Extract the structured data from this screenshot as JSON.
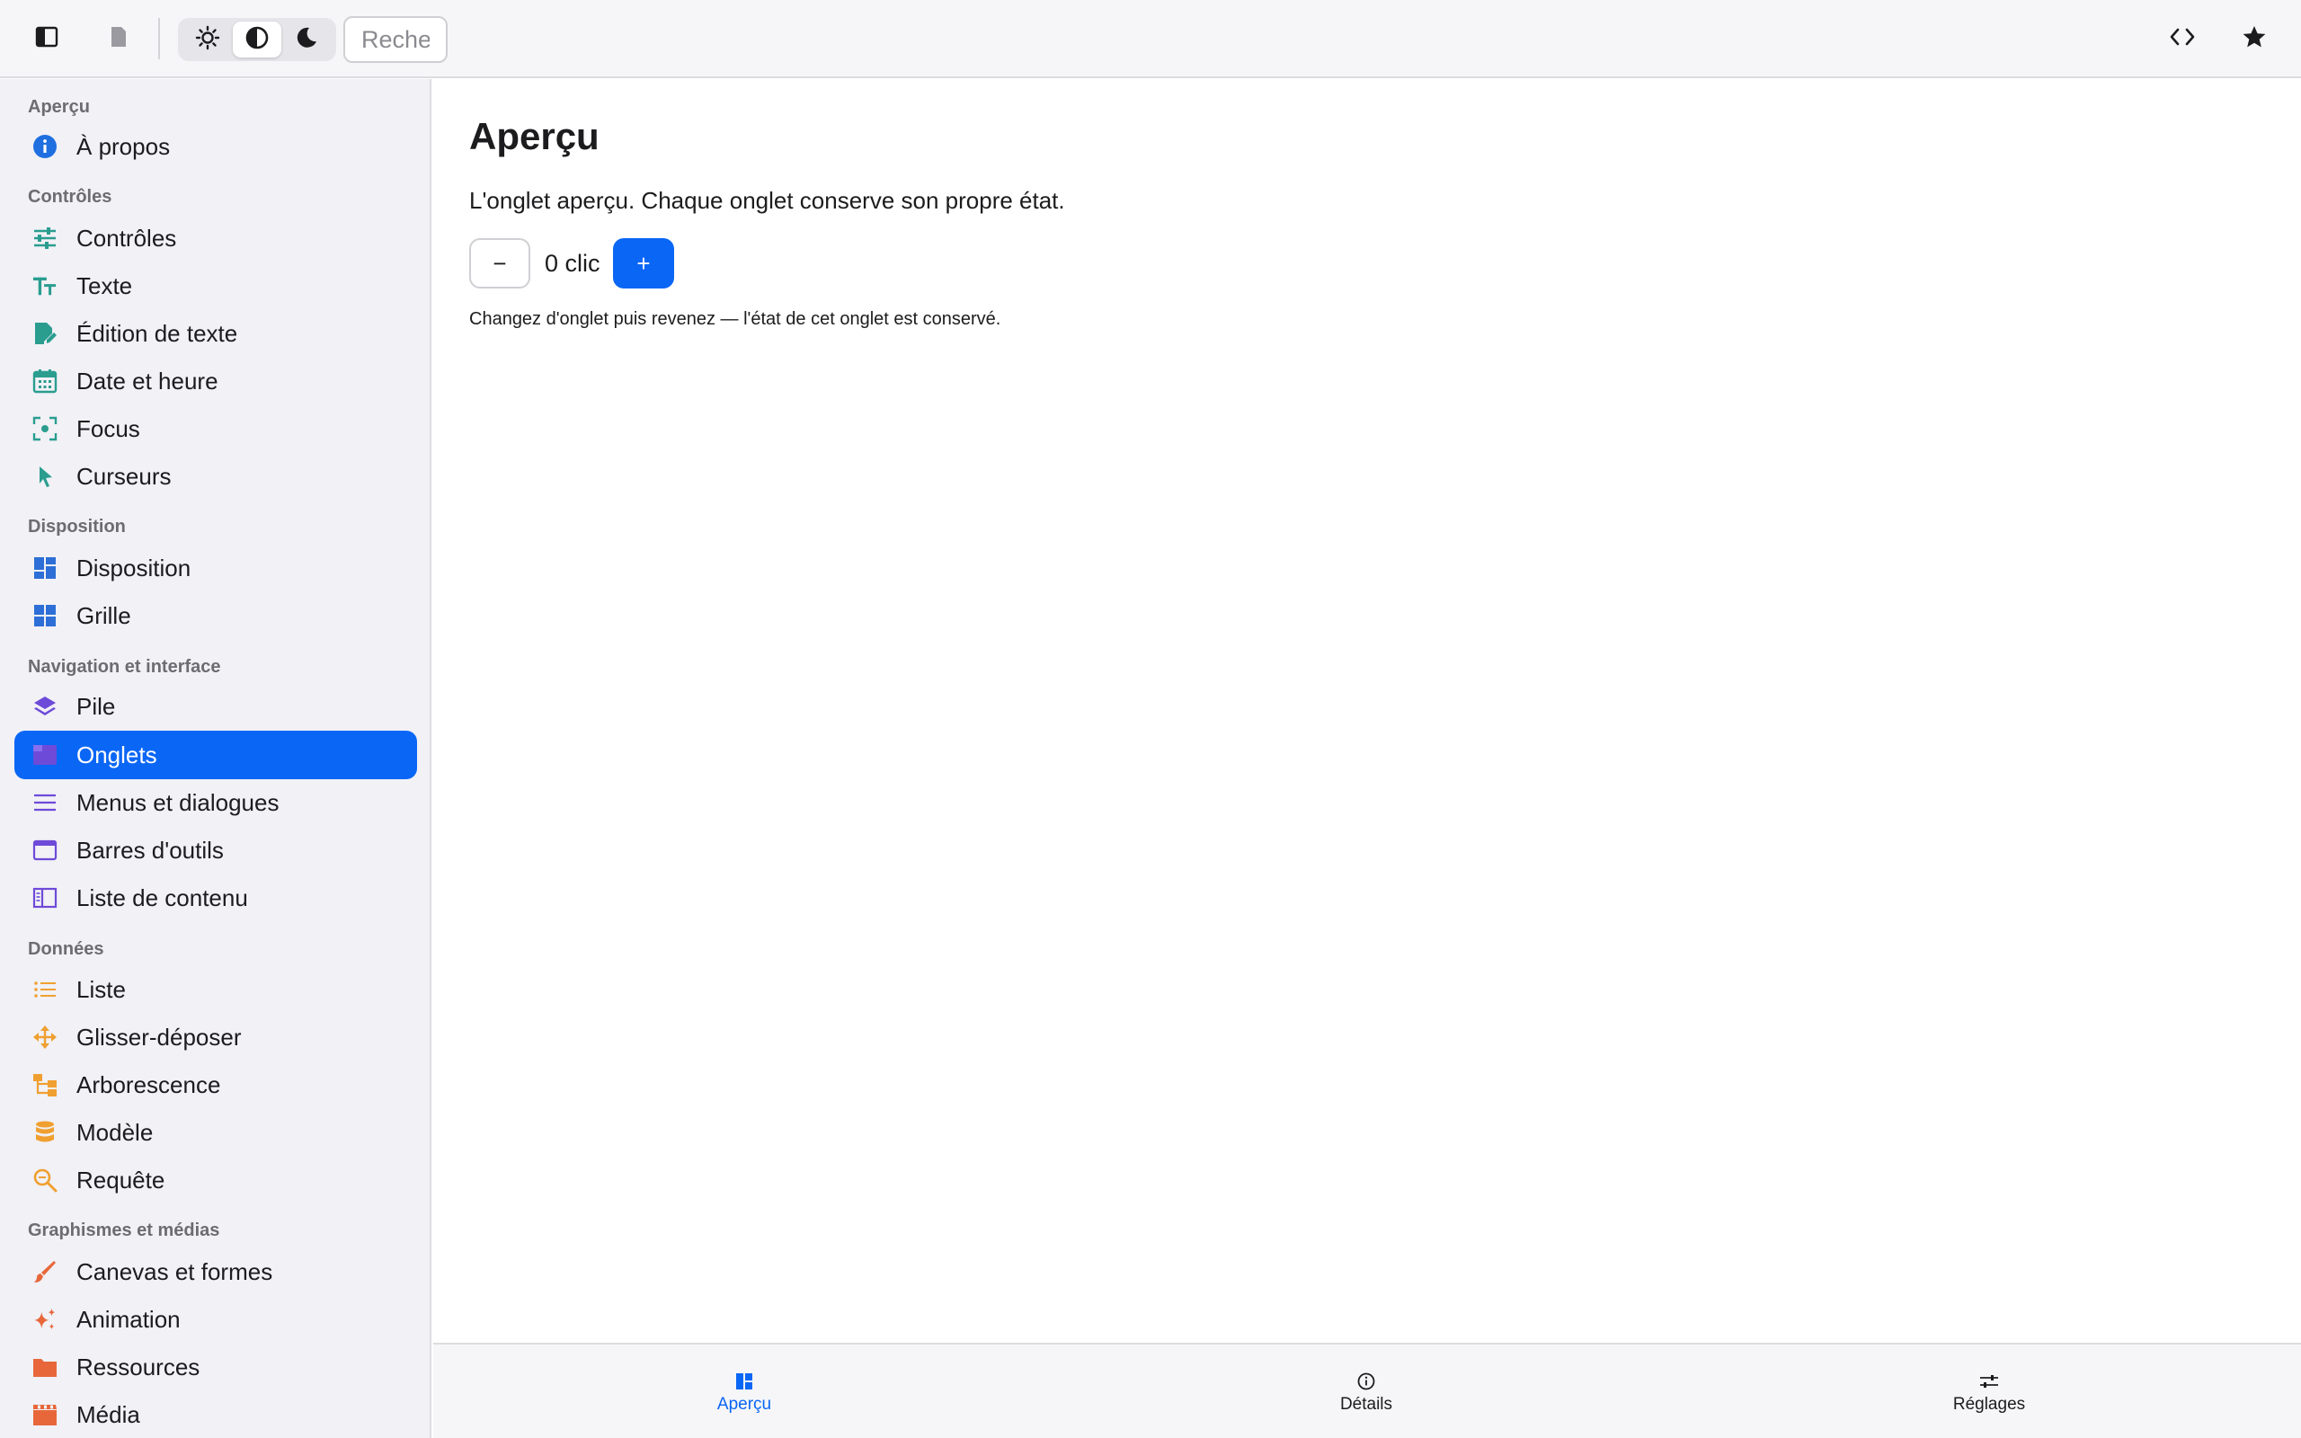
{
  "toolbar": {
    "sidebar_toggle_icon": "sidebar-icon",
    "document_icon": "document-icon",
    "theme_options": [
      {
        "name": "light",
        "icon": "sun-icon",
        "active": false
      },
      {
        "name": "auto",
        "icon": "contrast-icon",
        "active": true
      },
      {
        "name": "dark",
        "icon": "moon-icon",
        "active": false
      }
    ],
    "search_placeholder": "Rechercher",
    "code_icon": "code-icon",
    "favorite_icon": "star-icon"
  },
  "sidebar": {
    "sections": [
      {
        "label": "Aperçu",
        "items": [
          {
            "label": "À propos",
            "icon": "info-icon",
            "color": "#1f6fe0"
          }
        ]
      },
      {
        "label": "Contrôles",
        "items": [
          {
            "label": "Contrôles",
            "icon": "sliders-icon",
            "color": "#2a9d8f"
          },
          {
            "label": "Texte",
            "icon": "text-size-icon",
            "color": "#2a9d8f"
          },
          {
            "label": "Édition de texte",
            "icon": "edit-document-icon",
            "color": "#2a9d8f"
          },
          {
            "label": "Date et heure",
            "icon": "calendar-icon",
            "color": "#2a9d8f"
          },
          {
            "label": "Focus",
            "icon": "focus-icon",
            "color": "#2a9d8f"
          },
          {
            "label": "Curseurs",
            "icon": "cursor-icon",
            "color": "#2a9d8f"
          }
        ]
      },
      {
        "label": "Disposition",
        "items": [
          {
            "label": "Disposition",
            "icon": "layout-icon",
            "color": "#2d6fd6"
          },
          {
            "label": "Grille",
            "icon": "grid-icon",
            "color": "#2d6fd6"
          }
        ]
      },
      {
        "label": "Navigation et interface",
        "items": [
          {
            "label": "Pile",
            "icon": "stack-icon",
            "color": "#6e4ad8"
          },
          {
            "label": "Onglets",
            "icon": "tabs-icon",
            "color": "#6e4ad8",
            "active": true
          },
          {
            "label": "Menus et dialogues",
            "icon": "menu-icon",
            "color": "#6e4ad8"
          },
          {
            "label": "Barres d'outils",
            "icon": "toolbar-icon",
            "color": "#6e4ad8"
          },
          {
            "label": "Liste de contenu",
            "icon": "sidebar-list-icon",
            "color": "#6e4ad8"
          }
        ]
      },
      {
        "label": "Données",
        "items": [
          {
            "label": "Liste",
            "icon": "list-icon",
            "color": "#f0a030"
          },
          {
            "label": "Glisser-déposer",
            "icon": "move-icon",
            "color": "#f0a030"
          },
          {
            "label": "Arborescence",
            "icon": "tree-icon",
            "color": "#f0a030"
          },
          {
            "label": "Modèle",
            "icon": "database-icon",
            "color": "#f0a030"
          },
          {
            "label": "Requête",
            "icon": "search-zoom-icon",
            "color": "#f0a030"
          }
        ]
      },
      {
        "label": "Graphismes et médias",
        "items": [
          {
            "label": "Canevas et formes",
            "icon": "brush-icon",
            "color": "#e8673a"
          },
          {
            "label": "Animation",
            "icon": "sparkles-icon",
            "color": "#e8673a"
          },
          {
            "label": "Ressources",
            "icon": "folder-icon",
            "color": "#e8673a"
          },
          {
            "label": "Média",
            "icon": "film-icon",
            "color": "#e8673a"
          }
        ]
      }
    ]
  },
  "main": {
    "title": "Aperçu",
    "description": "L'onglet aperçu. Chaque onglet conserve son propre état.",
    "counter": {
      "minus_label": "−",
      "value_text": "0 clic",
      "plus_label": "+"
    },
    "hint": "Changez d'onglet puis revenez — l'état de cet onglet est conservé."
  },
  "tabbar": {
    "tabs": [
      {
        "label": "Aperçu",
        "icon": "overview-icon",
        "active": true
      },
      {
        "label": "Détails",
        "icon": "info-circle-icon",
        "active": false
      },
      {
        "label": "Réglages",
        "icon": "settings-sliders-icon",
        "active": false
      }
    ]
  },
  "colors": {
    "accent": "#0a66f5",
    "sidebar_bg": "#f1f1f6",
    "toolbar_bg": "#f6f6f8"
  }
}
